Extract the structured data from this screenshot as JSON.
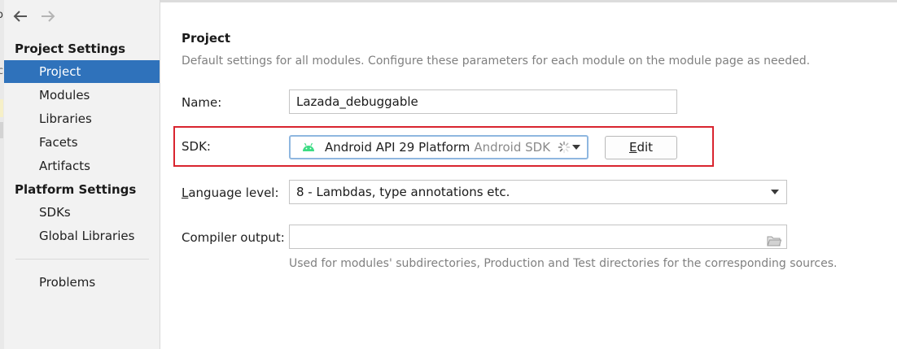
{
  "window_edge": {
    "frag1": "o",
    "frag2": "c"
  },
  "sidebar": {
    "project_settings_header": "Project Settings",
    "platform_settings_header": "Platform Settings",
    "project_items": [
      {
        "label": "Project",
        "selected": true
      },
      {
        "label": "Modules"
      },
      {
        "label": "Libraries"
      },
      {
        "label": "Facets"
      },
      {
        "label": "Artifacts"
      }
    ],
    "platform_items": [
      {
        "label": "SDKs"
      },
      {
        "label": "Global Libraries"
      }
    ],
    "problems_label": "Problems",
    "selection_color": "#2f72bb"
  },
  "icons": {
    "back": "arrow-left-icon",
    "forward": "arrow-right-icon",
    "android": "android-icon",
    "loading": "spinner-icon",
    "folder": "folder-icon"
  },
  "main": {
    "title": "Project",
    "description": "Default settings for all modules. Configure these parameters for each module on the module page as needed.",
    "name_label": "Name:",
    "name_value": "Lazada_debuggable",
    "sdk_label": "SDK:",
    "sdk_value": "Android API 29 Platform",
    "sdk_secondary": "Android SDK",
    "edit_button": {
      "mnemonic": "E",
      "rest": "dit"
    },
    "language_level": {
      "mnemonic": "L",
      "rest": "anguage level:",
      "value": "8 - Lambdas, type annotations etc."
    },
    "compiler_output_label": "Compiler output:",
    "compiler_output_value": "",
    "compiler_hint": "Used for modules' subdirectories, Production and Test directories for the corresponding sources."
  },
  "colors": {
    "highlight_border": "#d9252f",
    "android_green": "#3ddc84",
    "focus_border": "#8fb7e0"
  }
}
